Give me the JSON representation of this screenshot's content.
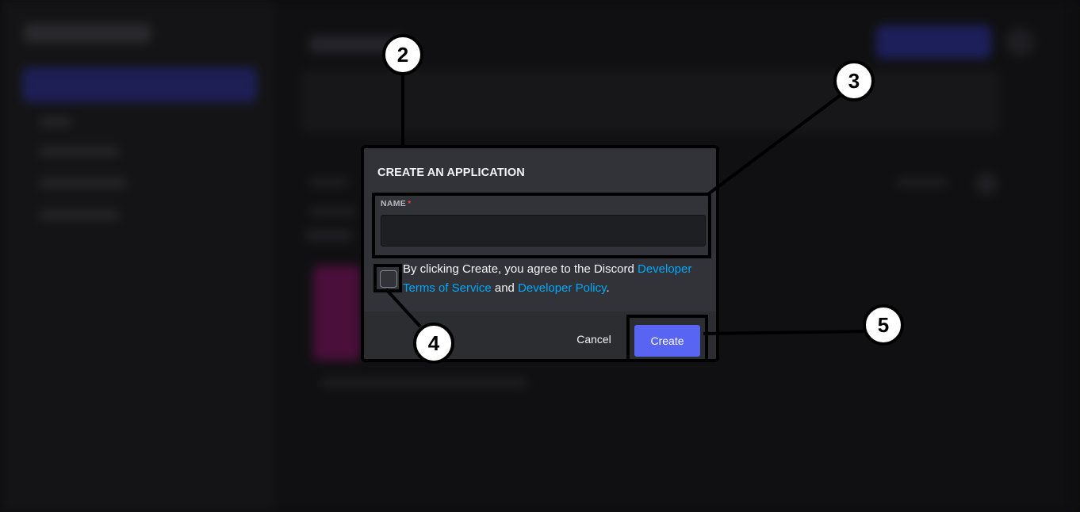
{
  "modal": {
    "title": "CREATE AN APPLICATION",
    "name_label": "NAME",
    "required_marker": "*",
    "name_value": "",
    "agreement": {
      "prefix": "By clicking Create, you agree to the Discord ",
      "link_terms": "Developer Terms of Service",
      "middle": " and ",
      "link_policy": "Developer Policy",
      "suffix": "."
    },
    "cancel_label": "Cancel",
    "create_label": "Create"
  },
  "annotations": {
    "step_2": "2",
    "step_3": "3",
    "step_4": "4",
    "step_5": "5"
  },
  "colors": {
    "modal_bg": "#313338",
    "footer_bg": "#2b2d31",
    "primary": "#5865f2",
    "link": "#00a8fc",
    "required": "#f23f43"
  }
}
